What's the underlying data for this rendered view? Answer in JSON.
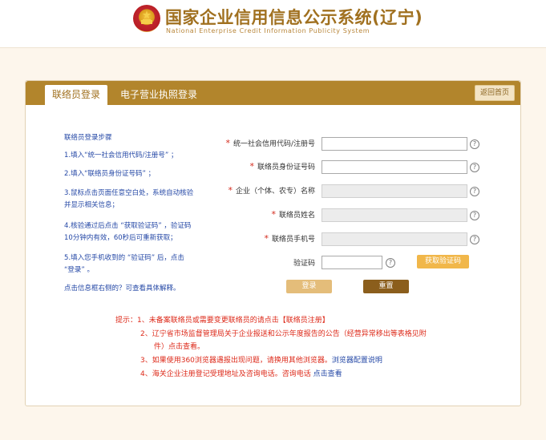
{
  "header": {
    "title": "国家企业信用信息公示系统(辽宁)",
    "subtitle": "National  Enterprise  Credit  Information  Publicity  System"
  },
  "tabs": {
    "active": "联络员登录",
    "inactive": "电子营业执照登录"
  },
  "home_button": "返回首页",
  "steps": [
    "联络员登录步骤",
    "1.填入“统一社会信用代码/注册号” ；",
    "2.填入“联络员身份证号码” ；",
    "3.鼠标点击页面任意空白处，系统自动核验",
    "并显示相关信息；",
    "4.核验通过后点击 “获取验证码” ，验证码",
    "10分钟内有效，60秒后可重新获取；",
    "5.填入您手机收到的 “验证码” 后，点击",
    "“登录” 。",
    "点击信息框右侧的？可查看具体解释。"
  ],
  "form": {
    "credit_code_label": "统一社会信用代码/注册号",
    "id_number_label": "联络员身份证号码",
    "company_name_label": "企业（个体、农专）名称",
    "liaison_name_label": "联络员姓名",
    "phone_label": "联络员手机号",
    "captcha_label": "验证码",
    "required_mark": "*",
    "help_mark": "?",
    "get_code_button": "获取验证码",
    "login_button": "登录",
    "reset_button": "重置"
  },
  "notes": {
    "prefix": "提示：",
    "n1_num": "1、",
    "n1_text": "未备案联络员或需要变更联络员的请点击",
    "n1_link": "【联络员注册】",
    "n2_num": "2、",
    "n2_line1": "辽宁省市场监督管理局关于企业报送和公示年度报告的公告（经营异常移出等表格见附",
    "n2_line2": "件）点击查看。",
    "n3_num": "3、",
    "n3_text": "如果使用360浏览器遇报出现问题，请换用其他浏览器。",
    "n3_link": "浏览器配置说明",
    "n4_num": "4、",
    "n4_text": "海关企业注册登记受理地址及咨询电话。咨询电话",
    "n4_link": "点击查看"
  }
}
